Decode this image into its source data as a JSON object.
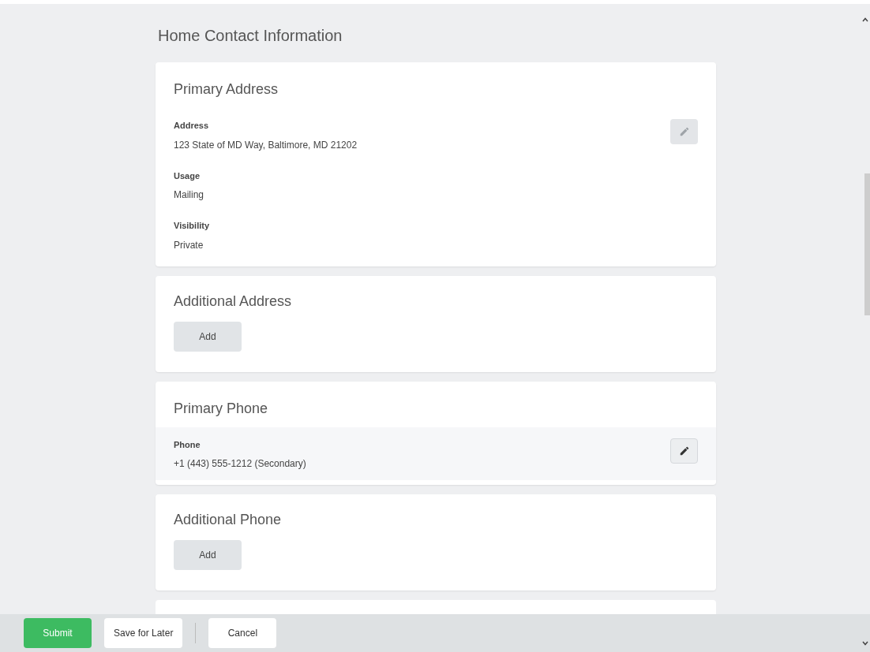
{
  "title": "Home Contact Information",
  "sections": [
    {
      "kind": "fields",
      "heading": "Primary Address",
      "highlighted": false,
      "fields": [
        {
          "label": "Address",
          "value": "123 State of MD Way, Baltimore, MD 21202"
        },
        {
          "label": "Usage",
          "value": "Mailing"
        },
        {
          "label": "Visibility",
          "value": "Private"
        }
      ]
    },
    {
      "kind": "add",
      "heading": "Additional Address",
      "button": "Add"
    },
    {
      "kind": "fields",
      "heading": "Primary Phone",
      "highlighted": true,
      "fields": [
        {
          "label": "Phone",
          "value": "+1 (443) 555-1212 (Secondary)"
        }
      ]
    },
    {
      "kind": "add",
      "heading": "Additional Phone",
      "button": "Add"
    }
  ],
  "actions": [
    {
      "label": "Submit",
      "kind": "primary"
    },
    {
      "label": "Save for Later",
      "kind": "secondary"
    },
    {
      "label": "Cancel",
      "kind": "secondary"
    }
  ]
}
